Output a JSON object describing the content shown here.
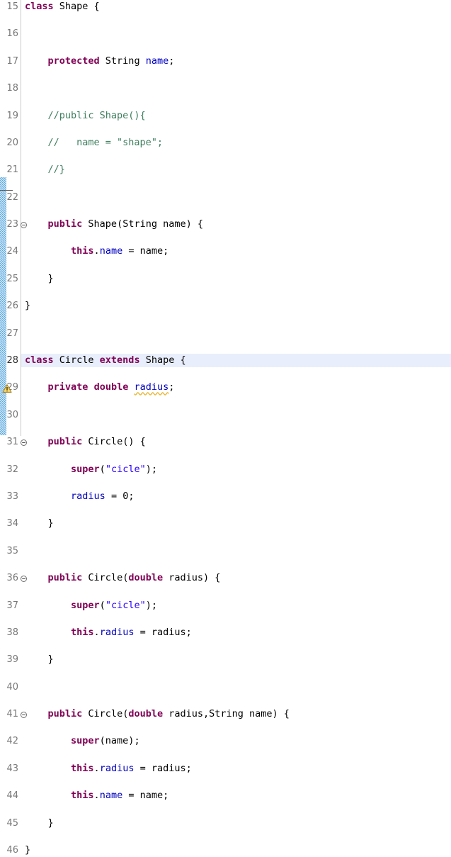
{
  "editor": {
    "language": "java",
    "first_line": 15,
    "last_line": 46,
    "current_line": 28,
    "colors": {
      "keyword": "#7f0055",
      "field": "#0000c0",
      "string": "#2a00ff",
      "comment": "#3f7f5f",
      "current_line_highlight": "#e8eefb",
      "change_bar": "#5aa6dd",
      "warning_squiggle": "#e8b42a",
      "gutter_separator": "#c8c8c8",
      "line_number": "#787878",
      "background": "#ffffff"
    },
    "markers": {
      "warning_line": 29,
      "warning_icon": "warning-triangle-icon",
      "fold_icon": "fold-collapse-icon",
      "fold_lines": [
        23,
        31,
        36,
        41
      ],
      "change_bar_start_line": 28,
      "change_bar_end_line": 46
    },
    "lines": [
      {
        "n": 15,
        "tokens": [
          {
            "t": "class",
            "c": "kw"
          },
          {
            "t": " Shape {",
            "c": "plain"
          }
        ]
      },
      {
        "n": 16,
        "tokens": []
      },
      {
        "n": 17,
        "tokens": [
          {
            "t": "    ",
            "c": "plain"
          },
          {
            "t": "protected",
            "c": "kw"
          },
          {
            "t": " String ",
            "c": "plain"
          },
          {
            "t": "name",
            "c": "fld"
          },
          {
            "t": ";",
            "c": "plain"
          }
        ]
      },
      {
        "n": 18,
        "tokens": []
      },
      {
        "n": 19,
        "tokens": [
          {
            "t": "    //public Shape(){",
            "c": "cmt"
          }
        ]
      },
      {
        "n": 20,
        "tokens": [
          {
            "t": "    //   name = \"shape\";",
            "c": "cmt"
          }
        ]
      },
      {
        "n": 21,
        "tokens": [
          {
            "t": "    //}",
            "c": "cmt"
          }
        ]
      },
      {
        "n": 22,
        "tokens": []
      },
      {
        "n": 23,
        "fold": true,
        "tokens": [
          {
            "t": "    ",
            "c": "plain"
          },
          {
            "t": "public",
            "c": "kw"
          },
          {
            "t": " Shape(String name) {",
            "c": "plain"
          }
        ]
      },
      {
        "n": 24,
        "tokens": [
          {
            "t": "        ",
            "c": "plain"
          },
          {
            "t": "this",
            "c": "kw"
          },
          {
            "t": ".",
            "c": "plain"
          },
          {
            "t": "name",
            "c": "fld"
          },
          {
            "t": " = name;",
            "c": "plain"
          }
        ]
      },
      {
        "n": 25,
        "tokens": [
          {
            "t": "    }",
            "c": "plain"
          }
        ]
      },
      {
        "n": 26,
        "tokens": [
          {
            "t": "}",
            "c": "plain"
          }
        ]
      },
      {
        "n": 27,
        "tokens": []
      },
      {
        "n": 28,
        "current": true,
        "tokens": [
          {
            "t": "class",
            "c": "kw"
          },
          {
            "t": " Circle ",
            "c": "plain"
          },
          {
            "t": "extends",
            "c": "kw"
          },
          {
            "t": " Shape {",
            "c": "plain"
          }
        ]
      },
      {
        "n": 29,
        "warning": true,
        "tokens": [
          {
            "t": "    ",
            "c": "plain"
          },
          {
            "t": "private",
            "c": "kw"
          },
          {
            "t": " ",
            "c": "plain"
          },
          {
            "t": "double",
            "c": "kw"
          },
          {
            "t": " ",
            "c": "plain"
          },
          {
            "t": "radius",
            "c": "fld warnline"
          },
          {
            "t": ";",
            "c": "plain"
          }
        ]
      },
      {
        "n": 30,
        "tokens": []
      },
      {
        "n": 31,
        "fold": true,
        "tokens": [
          {
            "t": "    ",
            "c": "plain"
          },
          {
            "t": "public",
            "c": "kw"
          },
          {
            "t": " Circle() {",
            "c": "plain"
          }
        ]
      },
      {
        "n": 32,
        "tokens": [
          {
            "t": "        ",
            "c": "plain"
          },
          {
            "t": "super",
            "c": "kw"
          },
          {
            "t": "(",
            "c": "plain"
          },
          {
            "t": "\"cicle\"",
            "c": "str"
          },
          {
            "t": ");",
            "c": "plain"
          }
        ]
      },
      {
        "n": 33,
        "tokens": [
          {
            "t": "        ",
            "c": "plain"
          },
          {
            "t": "radius",
            "c": "fld"
          },
          {
            "t": " = 0;",
            "c": "plain"
          }
        ]
      },
      {
        "n": 34,
        "tokens": [
          {
            "t": "    }",
            "c": "plain"
          }
        ]
      },
      {
        "n": 35,
        "tokens": []
      },
      {
        "n": 36,
        "fold": true,
        "tokens": [
          {
            "t": "    ",
            "c": "plain"
          },
          {
            "t": "public",
            "c": "kw"
          },
          {
            "t": " Circle(",
            "c": "plain"
          },
          {
            "t": "double",
            "c": "kw"
          },
          {
            "t": " radius) {",
            "c": "plain"
          }
        ]
      },
      {
        "n": 37,
        "tokens": [
          {
            "t": "        ",
            "c": "plain"
          },
          {
            "t": "super",
            "c": "kw"
          },
          {
            "t": "(",
            "c": "plain"
          },
          {
            "t": "\"cicle\"",
            "c": "str"
          },
          {
            "t": ");",
            "c": "plain"
          }
        ]
      },
      {
        "n": 38,
        "tokens": [
          {
            "t": "        ",
            "c": "plain"
          },
          {
            "t": "this",
            "c": "kw"
          },
          {
            "t": ".",
            "c": "plain"
          },
          {
            "t": "radius",
            "c": "fld"
          },
          {
            "t": " = radius;",
            "c": "plain"
          }
        ]
      },
      {
        "n": 39,
        "tokens": [
          {
            "t": "    }",
            "c": "plain"
          }
        ]
      },
      {
        "n": 40,
        "tokens": []
      },
      {
        "n": 41,
        "fold": true,
        "tokens": [
          {
            "t": "    ",
            "c": "plain"
          },
          {
            "t": "public",
            "c": "kw"
          },
          {
            "t": " Circle(",
            "c": "plain"
          },
          {
            "t": "double",
            "c": "kw"
          },
          {
            "t": " radius,String name) {",
            "c": "plain"
          }
        ]
      },
      {
        "n": 42,
        "tokens": [
          {
            "t": "        ",
            "c": "plain"
          },
          {
            "t": "super",
            "c": "kw"
          },
          {
            "t": "(name);",
            "c": "plain"
          }
        ]
      },
      {
        "n": 43,
        "tokens": [
          {
            "t": "        ",
            "c": "plain"
          },
          {
            "t": "this",
            "c": "kw"
          },
          {
            "t": ".",
            "c": "plain"
          },
          {
            "t": "radius",
            "c": "fld"
          },
          {
            "t": " = radius;",
            "c": "plain"
          }
        ]
      },
      {
        "n": 44,
        "tokens": [
          {
            "t": "        ",
            "c": "plain"
          },
          {
            "t": "this",
            "c": "kw"
          },
          {
            "t": ".",
            "c": "plain"
          },
          {
            "t": "name",
            "c": "fld"
          },
          {
            "t": " = name;",
            "c": "plain"
          }
        ]
      },
      {
        "n": 45,
        "tokens": [
          {
            "t": "    }",
            "c": "plain"
          }
        ]
      },
      {
        "n": 46,
        "tokens": [
          {
            "t": "}",
            "c": "plain"
          }
        ]
      }
    ]
  }
}
